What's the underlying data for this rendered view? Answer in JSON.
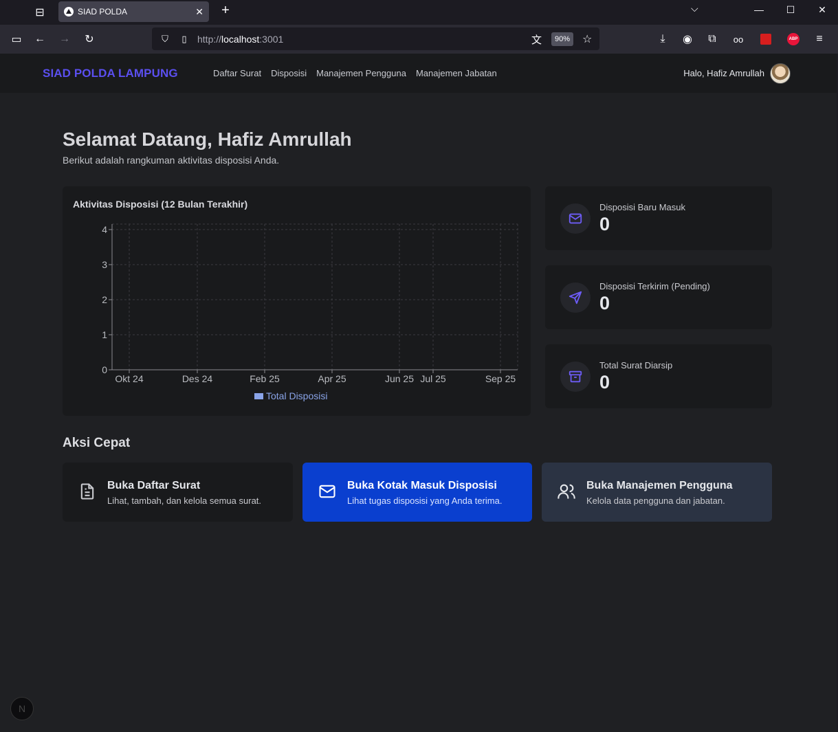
{
  "browser": {
    "tab_title": "SIAD POLDA",
    "url_protocol": "http://",
    "url_host": "localhost",
    "url_port": ":3001",
    "zoom": "90%"
  },
  "app": {
    "brand": "SIAD POLDA LAMPUNG",
    "menu": [
      "Daftar Surat",
      "Disposisi",
      "Manajemen Pengguna",
      "Manajemen Jabatan"
    ],
    "greeting": "Halo, Hafiz Amrullah"
  },
  "page": {
    "title": "Selamat Datang, Hafiz Amrullah",
    "subtitle": "Berikut adalah rangkuman aktivitas disposisi Anda."
  },
  "chart_data": {
    "type": "bar",
    "title": "Aktivitas Disposisi (12 Bulan Terakhir)",
    "x_tick_labels": [
      "Okt 24",
      "Des 24",
      "Feb 25",
      "Apr 25",
      "Jun 25",
      "Jul 25",
      "Sep 25"
    ],
    "y_tick_labels": [
      "0",
      "1",
      "2",
      "3",
      "4"
    ],
    "ylim": [
      0,
      4
    ],
    "series": [
      {
        "name": "Total Disposisi",
        "values": [
          0,
          0,
          0,
          0,
          0,
          0,
          0,
          0,
          0,
          0,
          0,
          0
        ]
      }
    ],
    "legend": "bottom-center",
    "grid": true,
    "series_color": "#8aa4e8"
  },
  "stats": [
    {
      "label": "Disposisi Baru Masuk",
      "value": "0",
      "icon": "mail-icon"
    },
    {
      "label": "Disposisi Terkirim (Pending)",
      "value": "0",
      "icon": "send-icon"
    },
    {
      "label": "Total Surat Diarsip",
      "value": "0",
      "icon": "archive-icon"
    }
  ],
  "quick_actions": {
    "heading": "Aksi Cepat",
    "items": [
      {
        "title": "Buka Daftar Surat",
        "desc": "Lihat, tambah, dan kelola semua surat.",
        "icon": "document-icon",
        "bg": "#191a1c"
      },
      {
        "title": "Buka Kotak Masuk Disposisi",
        "desc": "Lihat tugas disposisi yang Anda terima.",
        "icon": "mail-icon",
        "bg": "#0a3fcf"
      },
      {
        "title": "Buka Manajemen Pengguna",
        "desc": "Kelola data pengguna dan jabatan.",
        "icon": "users-icon",
        "bg": "#2b3343"
      }
    ]
  },
  "colors": {
    "brand": "#5b4ff0",
    "accent_icon": "#6d5cf6"
  }
}
